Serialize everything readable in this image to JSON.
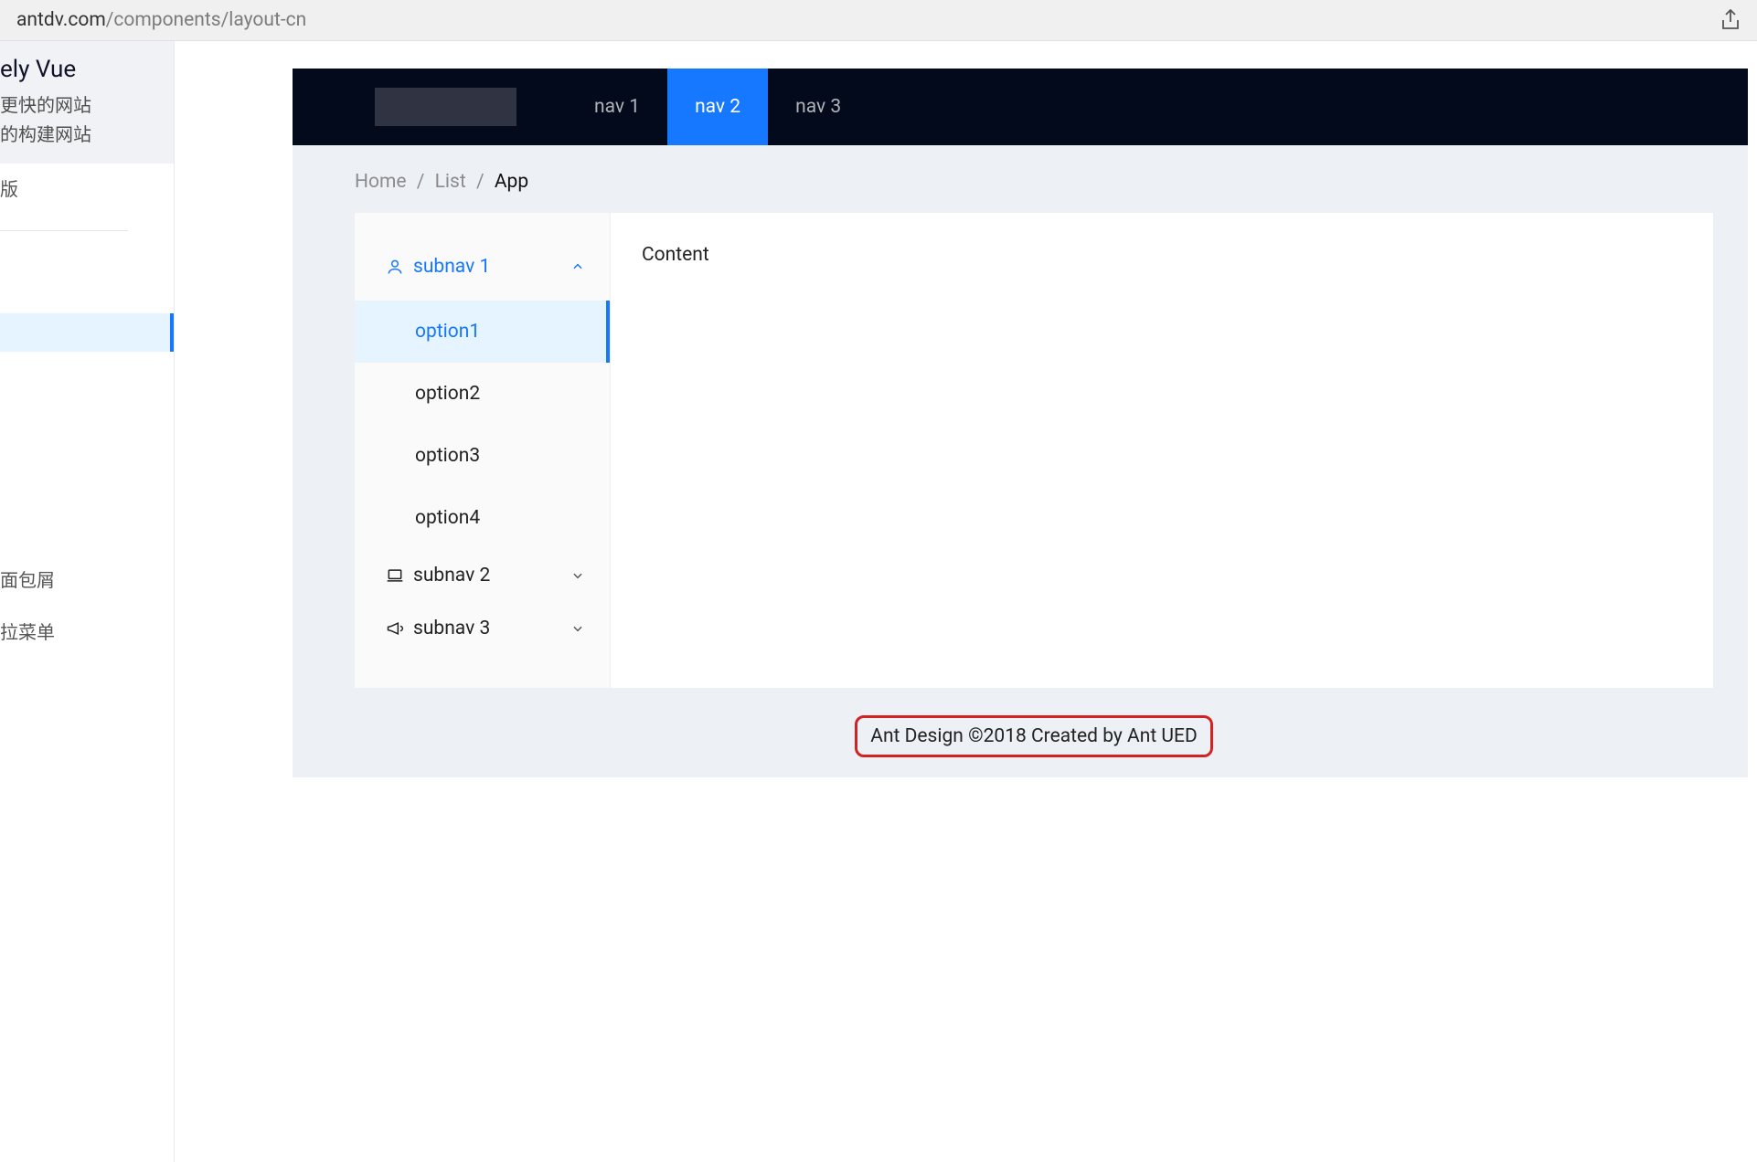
{
  "browser": {
    "domain": "antdv.com",
    "path": "/components/layout-cn"
  },
  "left_sidebar": {
    "title": "ely Vue",
    "lines": [
      "更快的网站",
      "的构建网站"
    ],
    "row1": "版",
    "bottom1": "面包屑",
    "bottom2": "拉菜单"
  },
  "header_nav": {
    "items": [
      {
        "label": "nav 1",
        "active": false
      },
      {
        "label": "nav 2",
        "active": true
      },
      {
        "label": "nav 3",
        "active": false
      }
    ]
  },
  "breadcrumb": {
    "items": [
      "Home",
      "List",
      "App"
    ],
    "sep": "/"
  },
  "side_menu": {
    "groups": [
      {
        "label": "subnav 1",
        "icon": "user-icon",
        "open": true,
        "options": [
          "option1",
          "option2",
          "option3",
          "option4"
        ],
        "selected": 0
      },
      {
        "label": "subnav 2",
        "icon": "laptop-icon",
        "open": false
      },
      {
        "label": "subnav 3",
        "icon": "megaphone-icon",
        "open": false
      }
    ]
  },
  "content": {
    "text": "Content"
  },
  "footer": {
    "text": "Ant Design ©2018 Created by Ant UED"
  }
}
